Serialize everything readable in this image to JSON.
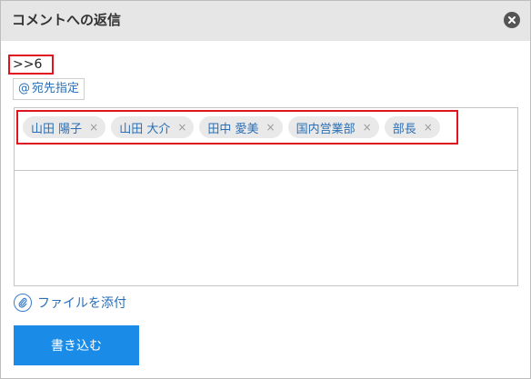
{
  "dialog": {
    "title": "コメントへの返信",
    "close_icon": "close-icon"
  },
  "reply": {
    "prefix": ">>6"
  },
  "address": {
    "icon": "@",
    "label": "宛先指定"
  },
  "recipients": [
    {
      "name": "山田 陽子",
      "remove": "×"
    },
    {
      "name": "山田 大介",
      "remove": "×"
    },
    {
      "name": "田中 愛美",
      "remove": "×"
    },
    {
      "name": "国内営業部",
      "remove": "×"
    },
    {
      "name": "部長",
      "remove": "×"
    }
  ],
  "comment": {
    "value": "",
    "placeholder": ""
  },
  "attach": {
    "icon": "paperclip-icon",
    "label": "ファイルを添付"
  },
  "submit": {
    "label": "書き込む"
  },
  "colors": {
    "accent": "#1a8ce8",
    "link": "#2a6fb5",
    "highlight": "#e0141e",
    "titlebar": "#e6e6e6"
  }
}
